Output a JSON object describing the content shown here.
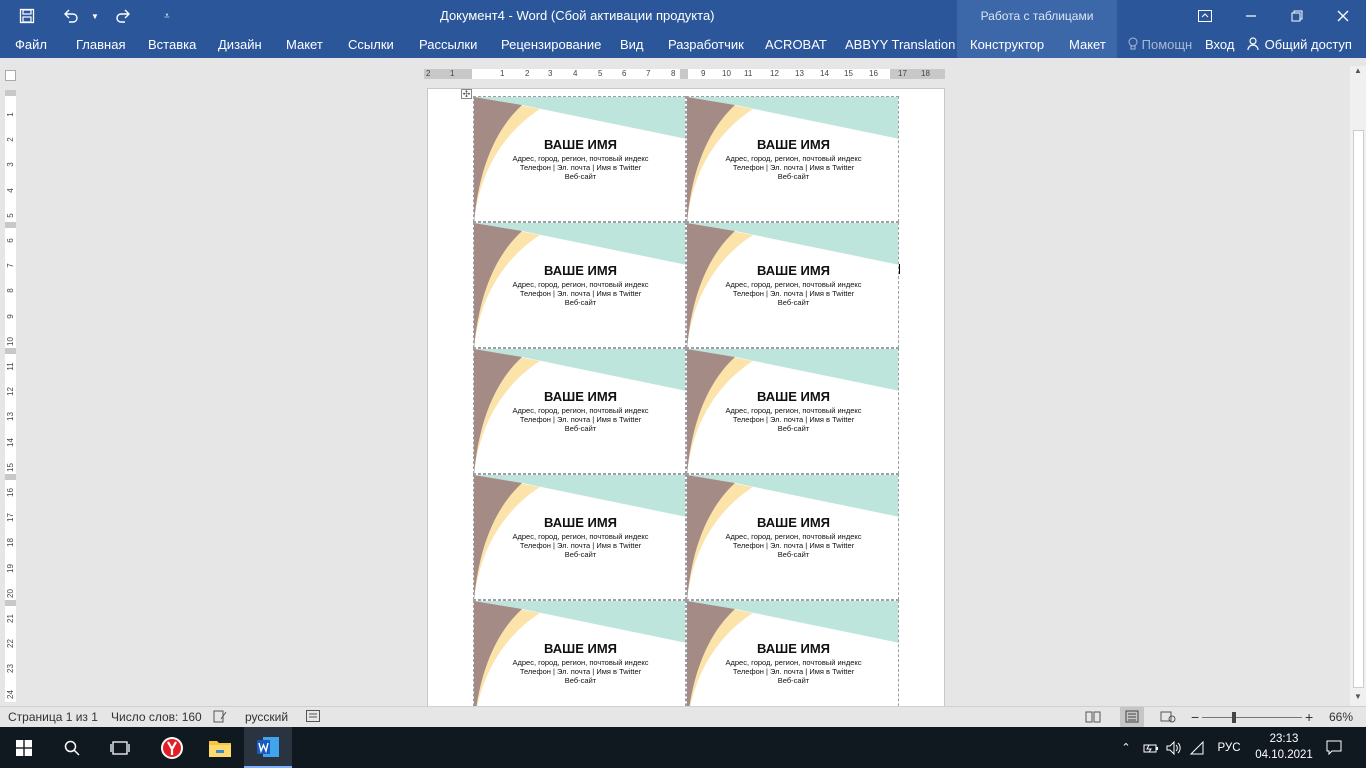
{
  "window": {
    "title": "Документ4 - Word (Сбой активации продукта)",
    "context_group": "Работа с таблицами"
  },
  "ribbon": {
    "tabs": [
      "Файл",
      "Главная",
      "Вставка",
      "Дизайн",
      "Макет",
      "Ссылки",
      "Рассылки",
      "Рецензирование",
      "Вид",
      "Разработчик",
      "ACROBAT",
      "ABBYY Translation",
      "Конструктор",
      "Макет"
    ],
    "help": "Помощн",
    "signin": "Вход",
    "share": "Общий доступ"
  },
  "hruler_numbers": [
    "2",
    "1",
    "1",
    "2",
    "3",
    "4",
    "5",
    "6",
    "7",
    "8",
    "9",
    "10",
    "11",
    "12",
    "13",
    "14",
    "15",
    "16",
    "17",
    "18"
  ],
  "vruler_numbers": [
    "1",
    "2",
    "3",
    "4",
    "5",
    "6",
    "7",
    "8",
    "9",
    "10",
    "11",
    "12",
    "13",
    "14",
    "15",
    "16",
    "17",
    "18",
    "19",
    "20",
    "21",
    "22",
    "23",
    "24"
  ],
  "cards": {
    "name": "ВАШЕ ИМЯ",
    "address": "Адрес, город, регион, почтовый индекс",
    "contacts": "Телефон | Эл. почта | Имя в Twitter",
    "website": "Веб-сайт",
    "rows": 5,
    "columns": 2
  },
  "colors": {
    "mauve": "#a58b86",
    "yellow": "#fbe3aa",
    "mint": "#bee5dc",
    "word_blue": "#2b579a"
  },
  "statusbar": {
    "page": "Страница 1 из 1",
    "words": "Число слов: 160",
    "language": "русский",
    "zoom": "66%"
  },
  "taskbar": {
    "language": "РУС",
    "time": "23:13",
    "date": "04.10.2021"
  }
}
